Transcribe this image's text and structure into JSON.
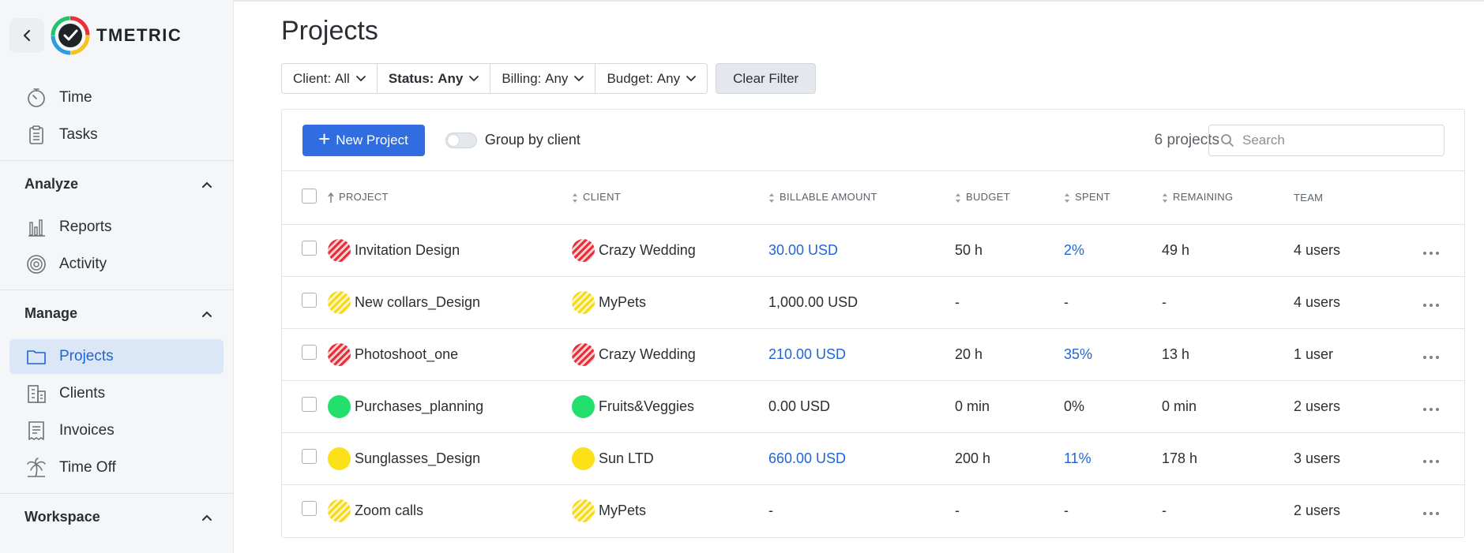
{
  "brand": {
    "name": "TMETRIC"
  },
  "sidebar": {
    "top_items": [
      {
        "label": "Time",
        "icon": "stopwatch-icon"
      },
      {
        "label": "Tasks",
        "icon": "clipboard-icon"
      }
    ],
    "sections": [
      {
        "title": "Analyze",
        "items": [
          {
            "label": "Reports",
            "icon": "bar-chart-icon"
          },
          {
            "label": "Activity",
            "icon": "activity-icon"
          }
        ]
      },
      {
        "title": "Manage",
        "items": [
          {
            "label": "Projects",
            "icon": "folder-icon",
            "active": true
          },
          {
            "label": "Clients",
            "icon": "building-icon"
          },
          {
            "label": "Invoices",
            "icon": "invoice-icon"
          },
          {
            "label": "Time Off",
            "icon": "palm-tree-icon"
          }
        ]
      },
      {
        "title": "Workspace",
        "items": []
      }
    ]
  },
  "page": {
    "title": "Projects"
  },
  "filters": {
    "client_prefix": "Client:",
    "client_value": "All",
    "status_prefix": "Status:",
    "status_value": "Any",
    "billing_prefix": "Billing:",
    "billing_value": "Any",
    "budget_prefix": "Budget:",
    "budget_value": "Any",
    "clear_label": "Clear Filter"
  },
  "toolbar": {
    "new_project_label": "New Project",
    "group_by_client_label": "Group by client",
    "group_by_client_on": false,
    "count_label": "6 projects",
    "search_placeholder": "Search"
  },
  "table": {
    "columns": [
      "PROJECT",
      "CLIENT",
      "BILLABLE AMOUNT",
      "BUDGET",
      "SPENT",
      "REMAINING",
      "TEAM"
    ],
    "rows": [
      {
        "project": "Invitation Design",
        "client": "Crazy Wedding",
        "color": "striped-red",
        "billable": "30.00 USD",
        "billable_link": true,
        "budget": "50 h",
        "spent": "2%",
        "spent_link": true,
        "remaining": "49 h",
        "team": "4 users"
      },
      {
        "project": "New collars_Design",
        "client": "MyPets",
        "color": "striped-yellow",
        "billable": "1,000.00 USD",
        "billable_link": false,
        "budget": "-",
        "spent": "-",
        "spent_link": false,
        "remaining": "-",
        "team": "4 users"
      },
      {
        "project": "Photoshoot_one",
        "client": "Crazy Wedding",
        "color": "striped-red",
        "billable": "210.00 USD",
        "billable_link": true,
        "budget": "20 h",
        "spent": "35%",
        "spent_link": true,
        "remaining": "13 h",
        "team": "1 user"
      },
      {
        "project": "Purchases_planning",
        "client": "Fruits&Veggies",
        "color": "solid-green",
        "billable": "0.00 USD",
        "billable_link": false,
        "budget": "0 min",
        "spent": "0%",
        "spent_link": false,
        "remaining": "0 min",
        "team": "2 users"
      },
      {
        "project": "Sunglasses_Design",
        "client": "Sun LTD",
        "color": "solid-yellow",
        "billable": "660.00 USD",
        "billable_link": true,
        "budget": "200 h",
        "spent": "11%",
        "spent_link": true,
        "remaining": "178 h",
        "team": "3 users"
      },
      {
        "project": "Zoom calls",
        "client": "MyPets",
        "color": "striped-yellow",
        "billable": "-",
        "billable_link": false,
        "budget": "-",
        "spent": "-",
        "spent_link": false,
        "remaining": "-",
        "team": "2 users"
      }
    ]
  },
  "colors": {
    "accent": "#2f6de1",
    "link": "#1f65d6",
    "active_nav_bg": "#dbe6f7"
  }
}
